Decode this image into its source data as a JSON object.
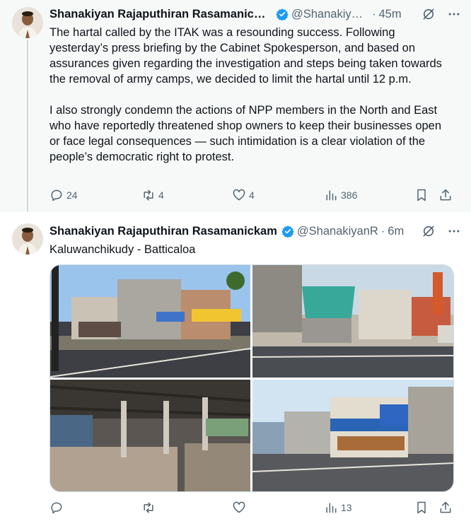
{
  "tweets": [
    {
      "author_name": "Shanakiyan Rajaputhiran Rasamanick…",
      "handle": "@Shanakiya…",
      "separator": "·",
      "time": "45m",
      "text": "The hartal called by the ITAK was a resounding success. Following yesterday’s press briefing by the Cabinet Spokesperson, and based on assurances given regarding the investigation and steps being taken towards the removal of army camps, we decided to limit the hartal until 12 p.m.\n\nI also strongly condemn the actions of NPP members in the North and East who have reportedly threatened shop owners to keep their businesses open or face legal consequences — such intimidation is a clear violation of the people’s democratic right to protest.",
      "replies": "24",
      "reposts": "4",
      "likes": "4",
      "views": "386"
    },
    {
      "author_name": "Shanakiyan Rajaputhiran Rasamanickam",
      "handle": "@ShanakiyanR",
      "separator": "·",
      "time": "6m",
      "text": "Kaluwanchikudy - Batticaloa",
      "replies": "",
      "reposts": "",
      "likes": "",
      "views": "13"
    }
  ],
  "icons": {
    "verified": "verified-badge-icon",
    "grok": "grok-icon",
    "more": "more-icon",
    "reply": "reply-icon",
    "repost": "repost-icon",
    "like": "like-icon",
    "views": "views-icon",
    "bookmark": "bookmark-icon",
    "share": "share-icon"
  },
  "colors": {
    "verified": "#1d9bf0",
    "secondary_text": "#536471",
    "primary_text": "#0f1419",
    "thread_background": "#f7f9f9"
  }
}
